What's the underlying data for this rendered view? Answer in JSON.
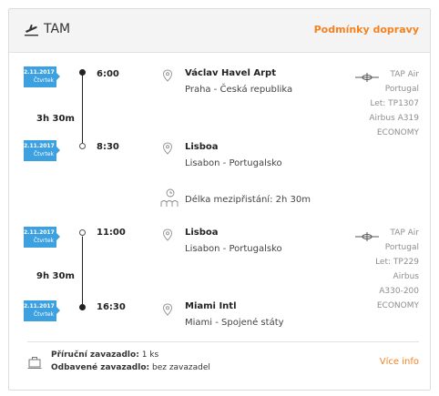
{
  "header": {
    "airline": "TAM",
    "conditions_link": "Podmínky dopravy"
  },
  "segments": [
    {
      "departure": {
        "date": "2.11.2017",
        "weekday": "Čtvrtek",
        "time": "6:00",
        "airport": "Václav Havel Arpt",
        "city": "Praha - Česká republika"
      },
      "duration": "3h 30m",
      "arrival": {
        "date": "2.11.2017",
        "weekday": "Čtvrtek",
        "time": "8:30",
        "airport": "Lisboa",
        "city": "Lisabon - Portugalsko"
      },
      "info": [
        "TAP Air",
        "Portugal",
        "Let: TP1307",
        "Airbus A319",
        "ECONOMY"
      ]
    },
    {
      "departure": {
        "date": "2.11.2017",
        "weekday": "Čtvrtek",
        "time": "11:00",
        "airport": "Lisboa",
        "city": "Lisabon - Portugalsko"
      },
      "duration": "9h 30m",
      "arrival": {
        "date": "2.11.2017",
        "weekday": "Čtvrtek",
        "time": "16:30",
        "airport": "Miami Intl",
        "city": "Miami - Spojené státy"
      },
      "info": [
        "TAP Air",
        "Portugal",
        "Let: TP229",
        "Airbus",
        "A330-200",
        "ECONOMY"
      ]
    }
  ],
  "layover": "Délka mezipřistání: 2h 30m",
  "baggage": {
    "cabin_label": "Příruční zavazadlo:",
    "cabin_value": "1 ks",
    "checked_label": "Odbavené zavazadlo:",
    "checked_value": "bez zavazadel"
  },
  "more_info": "Více info",
  "colors": {
    "accent": "#f58220",
    "badge": "#3da1e0"
  }
}
